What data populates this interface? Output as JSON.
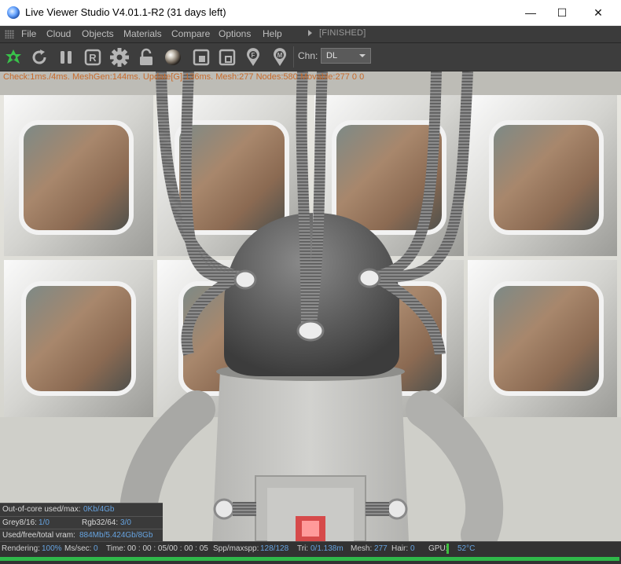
{
  "window": {
    "title": "Live Viewer Studio V4.01.1-R2 (31 days left)",
    "minimize_glyph": "—",
    "maximize_glyph": "☐",
    "close_glyph": "✕"
  },
  "menu": {
    "items": [
      "File",
      "Cloud",
      "Objects",
      "Materials",
      "Compare",
      "Options",
      "Help"
    ],
    "status": "[FINISHED]"
  },
  "toolbar": {
    "icons": [
      "refresh-nodes-icon",
      "restart-icon",
      "pause-icon",
      "r-icon",
      "settings-gear-icon",
      "lock-icon",
      "material-sphere-icon",
      "region-icon",
      "film-region-icon",
      "focus-pin-icon",
      "material-pin-icon"
    ],
    "channel_label": "Chn:",
    "channel_value": "DL"
  },
  "viewport": {
    "stats_line": "Check:1ms./4ms. MeshGen:144ms. Update[G]:136ms. Mesh:277 Nodes:580 Movable:277  0 0"
  },
  "memory": {
    "ooc_label": "Out-of-core used/max:",
    "ooc_value": "0Kb/4Gb",
    "grey_label": "Grey8/16:",
    "grey_value": "1/0",
    "rgb_label": "Rgb32/64:",
    "rgb_value": "3/0",
    "vram_label": "Used/free/total vram:",
    "vram_value": "884Mb/5.424Gb/8Gb"
  },
  "status": {
    "rendering_label": "Rendering:",
    "rendering_value": "100%",
    "ms_label": "Ms/sec:",
    "ms_value": "0",
    "time_label": "Time:",
    "time_value": "00 : 00 : 05/00 : 00 : 05",
    "spp_label": "Spp/maxspp:",
    "spp_value": "128/128",
    "tri_label": "Tri:",
    "tri_value": "0/1.138m",
    "mesh_label": "Mesh:",
    "mesh_value": "277",
    "hair_label": "Hair:",
    "hair_value": "0",
    "gpu_label": "GPU:",
    "gpu_temp": "52°C",
    "progress_percent": 100
  },
  "colors": {
    "accent_green": "#2fb84a",
    "value_blue": "#66a3e0",
    "stats_orange": "#c86a2a"
  }
}
